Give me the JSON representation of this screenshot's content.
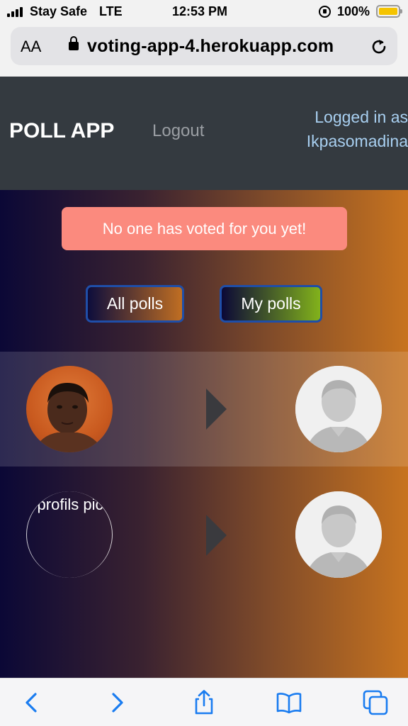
{
  "status": {
    "carrier": "Stay Safe",
    "network": "LTE",
    "time": "12:53 PM",
    "battery": "100%",
    "signal_icon": "signal-bars-icon",
    "rotation_lock_icon": "rotation-lock-icon",
    "battery_icon": "battery-icon"
  },
  "browser": {
    "text_size_label": "AA",
    "url": "voting-app-4.herokuapp.com",
    "lock_icon": "padlock-icon",
    "reload_icon": "reload-icon"
  },
  "header": {
    "brand": "POLL APP",
    "logout": "Logout",
    "logged_in_line1": "Logged in as",
    "logged_in_line2": "Ikpasomadina"
  },
  "main": {
    "alert": "No one has voted for you yet!",
    "all_polls": "All polls",
    "my_polls": "My polls",
    "broken_image_alt": "profils pic"
  },
  "toolbar": {
    "icons": [
      "back-icon",
      "forward-icon",
      "share-icon",
      "bookmarks-icon",
      "tabs-icon"
    ]
  },
  "colors": {
    "header_bg": "#343a40",
    "alert_bg": "#fb8a7e",
    "link_blue": "#a8cff0",
    "toolbar_blue": "#1a7cf0"
  }
}
